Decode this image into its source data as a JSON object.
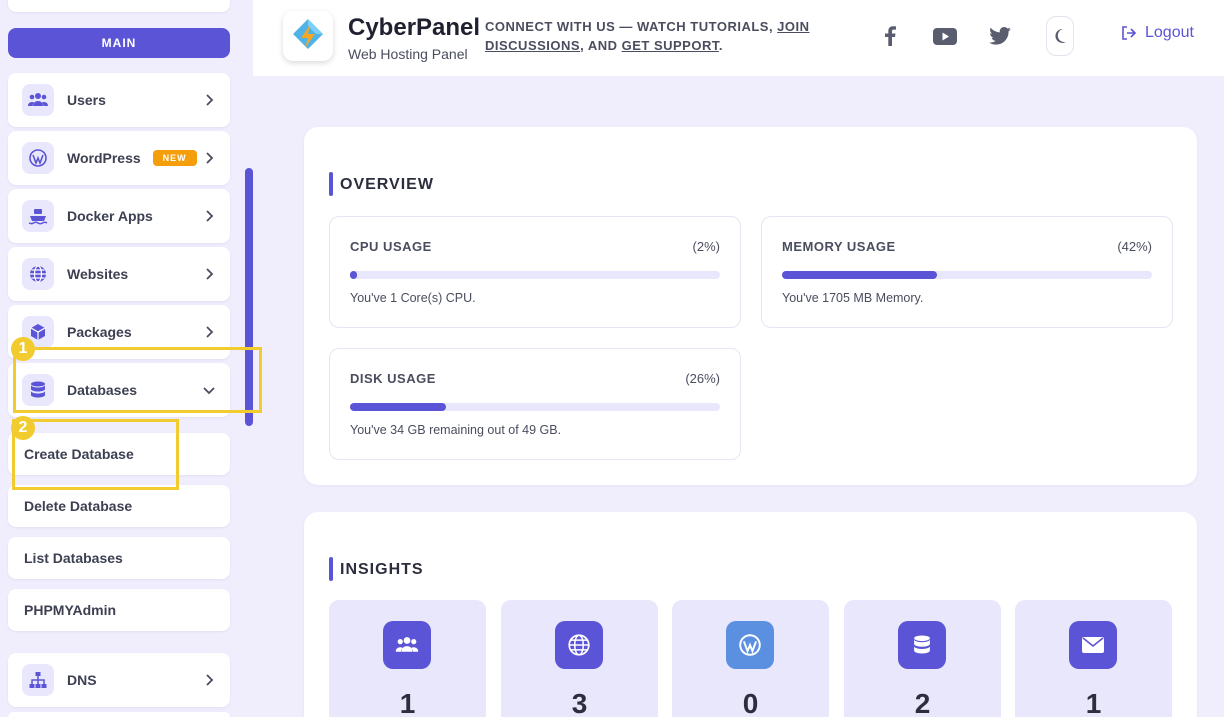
{
  "sidebar": {
    "main_label": "MAIN",
    "items": [
      {
        "label": "Users",
        "icon": "users-icon"
      },
      {
        "label": "WordPress",
        "icon": "wordpress-icon",
        "badge": "NEW"
      },
      {
        "label": "Docker Apps",
        "icon": "docker-icon"
      },
      {
        "label": "Websites",
        "icon": "globe-icon"
      },
      {
        "label": "Packages",
        "icon": "package-icon"
      },
      {
        "label": "Databases",
        "icon": "database-icon",
        "expanded": true
      },
      {
        "label": "DNS",
        "icon": "sitemap-icon"
      }
    ],
    "sub_items": [
      "Create Database",
      "Delete Database",
      "List Databases",
      "PHPMYAdmin"
    ],
    "highlights": [
      "1",
      "2"
    ]
  },
  "header": {
    "brand": "CyberPanel",
    "subtitle": "Web Hosting Panel",
    "connect_prefix": "CONNECT WITH US — WATCH TUTORIALS, ",
    "connect_link1": "JOIN DISCUSSIONS",
    "connect_mid": ", AND ",
    "connect_link2": "GET SUPPORT",
    "connect_suffix": ".",
    "logout_label": "Logout",
    "social_icons": [
      "facebook-icon",
      "youtube-icon",
      "twitter-icon"
    ]
  },
  "overview": {
    "title": "OVERVIEW",
    "cpu": {
      "title": "CPU USAGE",
      "percent": "(2%)",
      "value": 2,
      "desc": "You've 1 Core(s) CPU."
    },
    "memory": {
      "title": "MEMORY USAGE",
      "percent": "(42%)",
      "value": 42,
      "desc": "You've 1705 MB Memory."
    },
    "disk": {
      "title": "DISK USAGE",
      "percent": "(26%)",
      "value": 26,
      "desc": "You've 34 GB remaining out of 49 GB."
    }
  },
  "insights": {
    "title": "INSIGHTS",
    "cards": [
      {
        "icon": "users-icon",
        "value": "1"
      },
      {
        "icon": "globe-icon",
        "value": "3"
      },
      {
        "icon": "wordpress-icon",
        "value": "0"
      },
      {
        "icon": "database-icon",
        "value": "2"
      },
      {
        "icon": "envelope-icon",
        "value": "1"
      }
    ]
  },
  "colors": {
    "accent": "#5b54d6",
    "highlight": "#f2cc2e",
    "badge": "#f59e0b",
    "background": "#f0eefd"
  }
}
